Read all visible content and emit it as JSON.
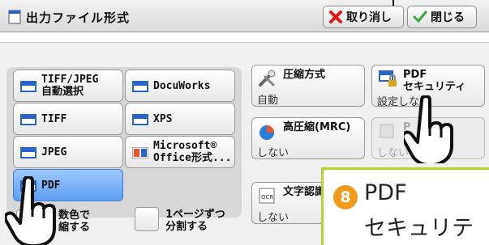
{
  "header": {
    "title": "出力ファイル形式",
    "cancel_label": "取り消し",
    "close_label": "閉じる"
  },
  "formats": {
    "tiff_jpeg_auto": [
      "TIFF/JPEG",
      "自動選択"
    ],
    "docuworks": "DocuWorks",
    "tiff": "TIFF",
    "xps": "XPS",
    "jpeg": "JPEG",
    "ms_office": [
      "Microsoft®",
      "Office形式..."
    ],
    "pdf": "PDF",
    "selected": "PDF"
  },
  "options": {
    "compression": {
      "title": "圧縮方式",
      "value": "自動"
    },
    "pdf_security": {
      "title": [
        "PDF",
        "セキュリティ"
      ],
      "value": "設定しない"
    },
    "high_compression": {
      "title": "高圧縮(MRC)",
      "value": "しない"
    },
    "disabled_option": {
      "title": "P",
      "value": "しない"
    },
    "ocr": {
      "title": "文字認識",
      "value": "しない"
    },
    "multicolor": [
      "数色で",
      "縮する"
    ],
    "split_pages": [
      "1ページずつ",
      "分割する"
    ]
  },
  "callout": {
    "step": "8",
    "line1": "PDF",
    "line2": "セキュリテ"
  },
  "colors": {
    "selected": "#5f9ff0",
    "callout_border": "#b6d12e",
    "step_badge": "#f29a1b",
    "cancel_x": "#e01818"
  }
}
